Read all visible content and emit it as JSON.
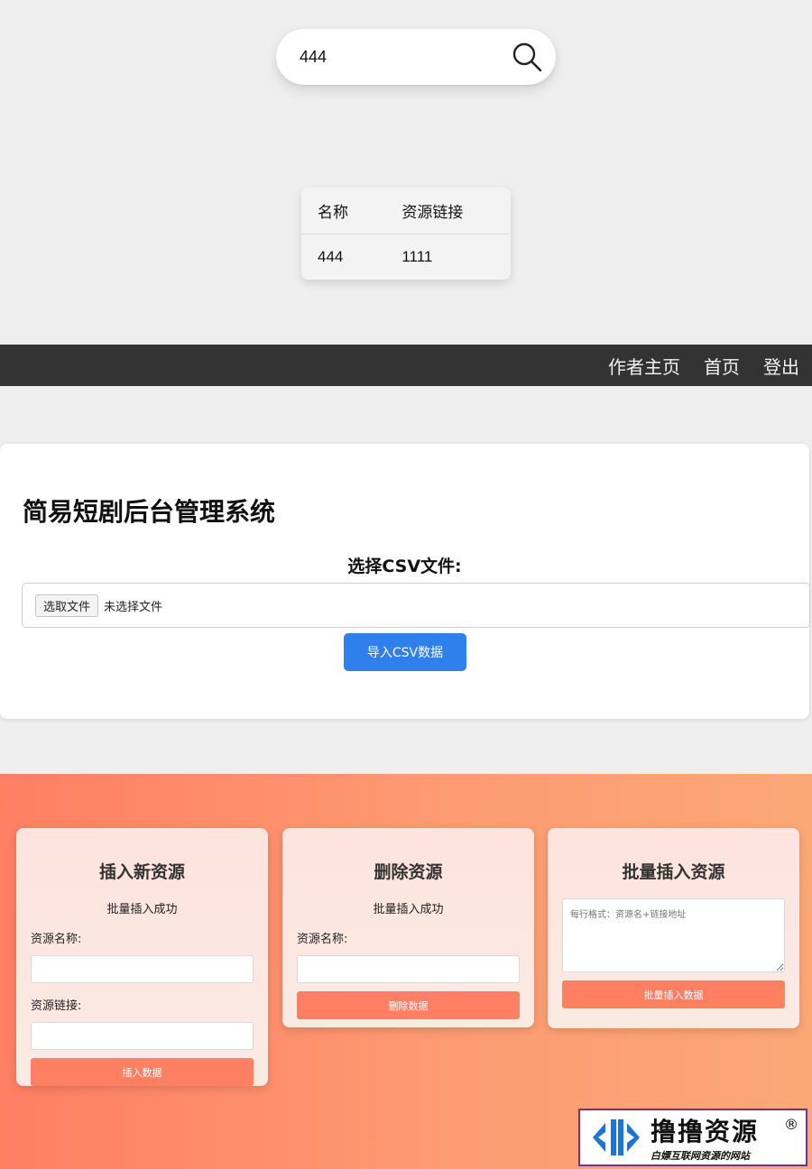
{
  "search": {
    "value": "444"
  },
  "results": {
    "headers": [
      "名称",
      "资源链接"
    ],
    "rows": [
      [
        "444",
        "1111"
      ]
    ]
  },
  "nav": {
    "items": [
      "作者主页",
      "首页",
      "登出"
    ]
  },
  "admin": {
    "title": "简易短剧后台管理系统",
    "csv_label": "选择CSV文件:",
    "file_button": "选取文件",
    "file_status": "未选择文件",
    "import_button": "导入CSV数据"
  },
  "cards": {
    "insert": {
      "title": "插入新资源",
      "message": "批量插入成功",
      "name_label": "资源名称:",
      "link_label": "资源链接:",
      "button": "插入数据"
    },
    "delete": {
      "title": "删除资源",
      "message": "批量插入成功",
      "name_label": "资源名称:",
      "button": "删除数据"
    },
    "batch": {
      "title": "批量插入资源",
      "placeholder": "每行格式：资源名+链接地址",
      "button": "批量插入数据"
    }
  },
  "watermark": {
    "main": "撸撸资源",
    "sub": "白嫖互联网资源的网站",
    "reg": "®"
  },
  "colors": {
    "accent_blue": "#2f80ed",
    "nav_bg": "#333333",
    "coral": "#ff7f63"
  }
}
